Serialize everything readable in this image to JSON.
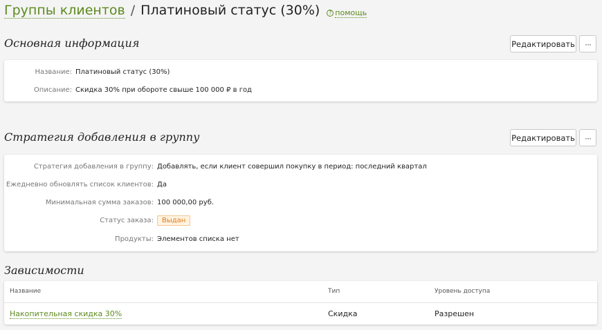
{
  "header": {
    "breadcrumb": "Группы клиентов",
    "separator": "/",
    "title": "Платиновый статус (30%)",
    "help_icon": "?",
    "help_label": "помощь"
  },
  "basic_info": {
    "title": "Основная информация",
    "edit_label": "Редактировать",
    "more_label": "···",
    "rows": [
      {
        "label": "Название:",
        "value": "Платиновый статус (30%)"
      },
      {
        "label": "Описание:",
        "value": "Скидка 30% при обороте свыше 100 000 ₽ в год"
      }
    ]
  },
  "strategy": {
    "title": "Стратегия добавления в группу",
    "edit_label": "Редактировать",
    "more_label": "···",
    "rows": [
      {
        "label": "Стратегия добавления в группу:",
        "value": "Добавлять, если клиент совершил покупку в период: последний квартал"
      },
      {
        "label": "Ежедневно обновлять список клиентов:",
        "value": "Да"
      },
      {
        "label": "Минимальная сумма заказов:",
        "value": "100 000,00 руб."
      },
      {
        "label": "Статус заказа:",
        "value": "Выдан"
      },
      {
        "label": "Продукты:",
        "value": "Элементов списка нет"
      }
    ],
    "status_badge_color": "#e07b12"
  },
  "dependencies": {
    "title": "Зависимости",
    "columns": [
      "Название",
      "Тип",
      "Уровень доступа"
    ],
    "rows": [
      {
        "name": "Накопительная скидка 30%",
        "type": "Скидка",
        "access": "Разрешен"
      }
    ]
  },
  "colors": {
    "accent": "#5c8a1e",
    "background": "#f4f4f4"
  }
}
